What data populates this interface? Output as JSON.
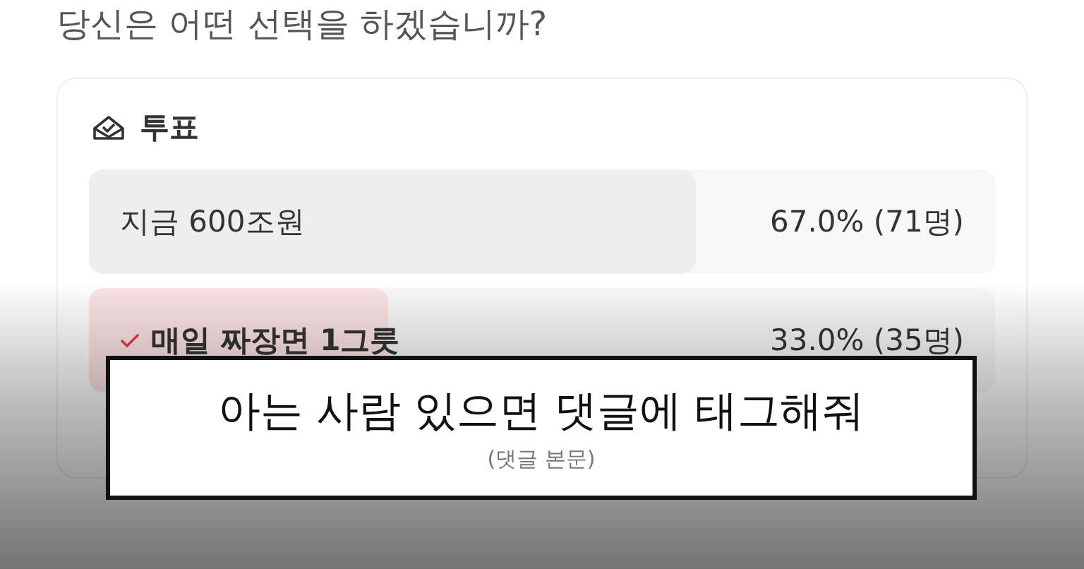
{
  "question": "당신은 어떤 선택을 하겠습니까?",
  "poll": {
    "title": "투표",
    "options": [
      {
        "label": "지금 600조원",
        "result": "67.0% (71명)",
        "level": 0.67,
        "selected": false
      },
      {
        "label": "매일 짜장면 1그릇",
        "result": "33.0% (35명)",
        "level": 0.33,
        "selected": true
      }
    ]
  },
  "caption": {
    "text": "아는 사람 있으면 댓글에 태그해줘",
    "source": "(댓글 본문)"
  }
}
